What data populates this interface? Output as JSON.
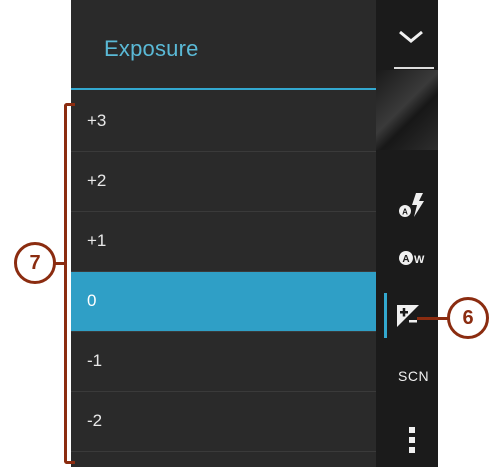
{
  "panel": {
    "title": "Exposure",
    "options": [
      "+3",
      "+2",
      "+1",
      "0",
      "-1",
      "-2"
    ],
    "selected": "0"
  },
  "sidebar": {
    "scene_label": "SCN",
    "icons": [
      "collapse-chevron-icon",
      "flash-auto-icon",
      "white-balance-auto-icon",
      "exposure-icon",
      "more-vert-icon"
    ]
  },
  "callouts": {
    "list": "7",
    "exposure_button": "6"
  },
  "colors": {
    "accent": "#33a8cf",
    "selected_row": "#2f9fc6",
    "callout": "#8b2c10"
  }
}
